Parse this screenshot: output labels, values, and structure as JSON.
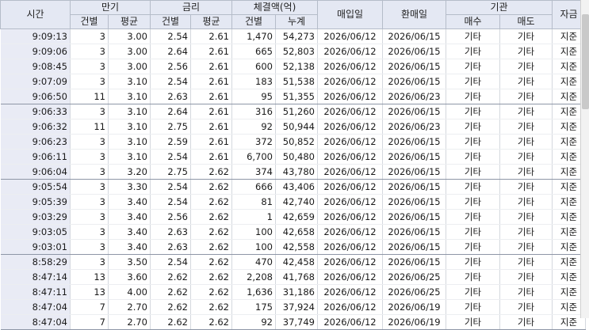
{
  "headers": {
    "time": "시간",
    "maturity": "만기",
    "maturity_count": "건별",
    "maturity_avg": "평균",
    "rate": "금리",
    "rate_each": "건별",
    "rate_avg": "평균",
    "amount": "체결액(억)",
    "amount_each": "건별",
    "amount_cum": "누계",
    "buy_date": "매입일",
    "sell_date": "환매일",
    "institution": "기관",
    "inst_buy": "매수",
    "inst_sell": "매도",
    "fund": "자금"
  },
  "rows": [
    {
      "time": "9:09:13",
      "mat": "3",
      "mat_avg": "3.00",
      "rate": "2.54",
      "rate_avg": "2.61",
      "amt": "1,470",
      "cum": "54,273",
      "buy": "2026/06/12",
      "sell": "2026/06/15",
      "ib": "기타",
      "is": "기타",
      "fund": "지준"
    },
    {
      "time": "9:09:06",
      "mat": "3",
      "mat_avg": "3.00",
      "rate": "2.64",
      "rate_avg": "2.61",
      "amt": "665",
      "cum": "52,803",
      "buy": "2026/06/12",
      "sell": "2026/06/15",
      "ib": "기타",
      "is": "기타",
      "fund": "지준"
    },
    {
      "time": "9:08:45",
      "mat": "3",
      "mat_avg": "3.00",
      "rate": "2.56",
      "rate_avg": "2.61",
      "amt": "600",
      "cum": "52,138",
      "buy": "2026/06/12",
      "sell": "2026/06/15",
      "ib": "기타",
      "is": "기타",
      "fund": "지준"
    },
    {
      "time": "9:07:09",
      "mat": "3",
      "mat_avg": "3.10",
      "rate": "2.54",
      "rate_avg": "2.61",
      "amt": "183",
      "cum": "51,538",
      "buy": "2026/06/12",
      "sell": "2026/06/15",
      "ib": "기타",
      "is": "기타",
      "fund": "지준"
    },
    {
      "time": "9:06:50",
      "mat": "11",
      "mat_avg": "3.10",
      "rate": "2.63",
      "rate_avg": "2.61",
      "amt": "95",
      "cum": "51,355",
      "buy": "2026/06/12",
      "sell": "2026/06/23",
      "ib": "기타",
      "is": "기타",
      "fund": "지준"
    },
    {
      "time": "9:06:33",
      "mat": "3",
      "mat_avg": "3.10",
      "rate": "2.64",
      "rate_avg": "2.61",
      "amt": "316",
      "cum": "51,260",
      "buy": "2026/06/12",
      "sell": "2026/06/15",
      "ib": "기타",
      "is": "기타",
      "fund": "지준"
    },
    {
      "time": "9:06:32",
      "mat": "11",
      "mat_avg": "3.10",
      "rate": "2.75",
      "rate_avg": "2.61",
      "amt": "92",
      "cum": "50,944",
      "buy": "2026/06/12",
      "sell": "2026/06/23",
      "ib": "기타",
      "is": "기타",
      "fund": "지준"
    },
    {
      "time": "9:06:23",
      "mat": "3",
      "mat_avg": "3.10",
      "rate": "2.59",
      "rate_avg": "2.61",
      "amt": "372",
      "cum": "50,852",
      "buy": "2026/06/12",
      "sell": "2026/06/15",
      "ib": "기타",
      "is": "기타",
      "fund": "지준"
    },
    {
      "time": "9:06:11",
      "mat": "3",
      "mat_avg": "3.10",
      "rate": "2.54",
      "rate_avg": "2.61",
      "amt": "6,700",
      "cum": "50,480",
      "buy": "2026/06/12",
      "sell": "2026/06/15",
      "ib": "기타",
      "is": "기타",
      "fund": "지준"
    },
    {
      "time": "9:06:04",
      "mat": "3",
      "mat_avg": "3.20",
      "rate": "2.75",
      "rate_avg": "2.62",
      "amt": "374",
      "cum": "43,780",
      "buy": "2026/06/12",
      "sell": "2026/06/15",
      "ib": "기타",
      "is": "기타",
      "fund": "지준"
    },
    {
      "time": "9:05:54",
      "mat": "3",
      "mat_avg": "3.30",
      "rate": "2.54",
      "rate_avg": "2.62",
      "amt": "666",
      "cum": "43,406",
      "buy": "2026/06/12",
      "sell": "2026/06/15",
      "ib": "기타",
      "is": "기타",
      "fund": "지준"
    },
    {
      "time": "9:05:39",
      "mat": "3",
      "mat_avg": "3.40",
      "rate": "2.54",
      "rate_avg": "2.62",
      "amt": "81",
      "cum": "42,740",
      "buy": "2026/06/12",
      "sell": "2026/06/15",
      "ib": "기타",
      "is": "기타",
      "fund": "지준"
    },
    {
      "time": "9:03:29",
      "mat": "3",
      "mat_avg": "3.40",
      "rate": "2.56",
      "rate_avg": "2.62",
      "amt": "1",
      "cum": "42,659",
      "buy": "2026/06/12",
      "sell": "2026/06/15",
      "ib": "기타",
      "is": "기타",
      "fund": "지준"
    },
    {
      "time": "9:03:05",
      "mat": "3",
      "mat_avg": "3.40",
      "rate": "2.63",
      "rate_avg": "2.62",
      "amt": "100",
      "cum": "42,658",
      "buy": "2026/06/12",
      "sell": "2026/06/15",
      "ib": "기타",
      "is": "기타",
      "fund": "지준"
    },
    {
      "time": "9:03:01",
      "mat": "3",
      "mat_avg": "3.40",
      "rate": "2.63",
      "rate_avg": "2.62",
      "amt": "100",
      "cum": "42,558",
      "buy": "2026/06/12",
      "sell": "2026/06/15",
      "ib": "기타",
      "is": "기타",
      "fund": "지준"
    },
    {
      "time": "8:58:29",
      "mat": "3",
      "mat_avg": "3.50",
      "rate": "2.54",
      "rate_avg": "2.62",
      "amt": "470",
      "cum": "42,458",
      "buy": "2026/06/12",
      "sell": "2026/06/15",
      "ib": "기타",
      "is": "기타",
      "fund": "지준"
    },
    {
      "time": "8:47:14",
      "mat": "13",
      "mat_avg": "3.60",
      "rate": "2.62",
      "rate_avg": "2.62",
      "amt": "2,208",
      "cum": "41,768",
      "buy": "2026/06/12",
      "sell": "2026/06/25",
      "ib": "기타",
      "is": "기타",
      "fund": "지준"
    },
    {
      "time": "8:47:11",
      "mat": "13",
      "mat_avg": "4.00",
      "rate": "2.62",
      "rate_avg": "2.62",
      "amt": "1,636",
      "cum": "31,186",
      "buy": "2026/06/12",
      "sell": "2026/06/25",
      "ib": "기타",
      "is": "기타",
      "fund": "지준"
    },
    {
      "time": "8:47:04",
      "mat": "7",
      "mat_avg": "2.70",
      "rate": "2.62",
      "rate_avg": "2.62",
      "amt": "175",
      "cum": "37,924",
      "buy": "2026/06/12",
      "sell": "2026/06/19",
      "ib": "기타",
      "is": "기타",
      "fund": "지준"
    },
    {
      "time": "8:47:04",
      "mat": "7",
      "mat_avg": "2.70",
      "rate": "2.62",
      "rate_avg": "2.62",
      "amt": "92",
      "cum": "37,749",
      "buy": "2026/06/12",
      "sell": "2026/06/19",
      "ib": "기타",
      "is": "기타",
      "fund": "지준"
    }
  ]
}
